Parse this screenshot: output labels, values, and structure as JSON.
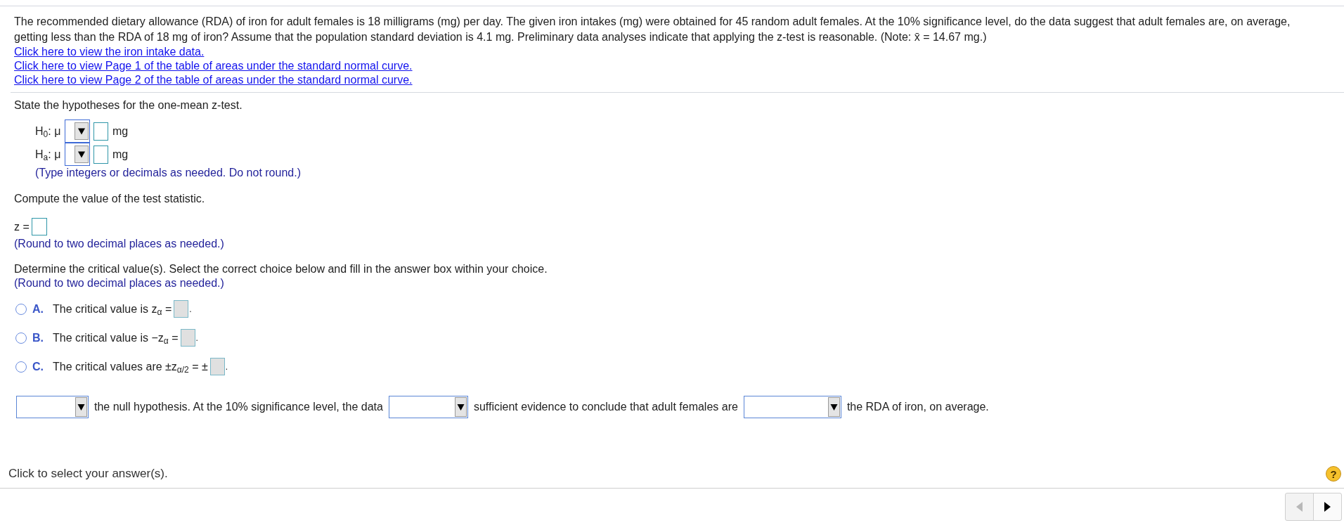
{
  "problem": {
    "paragraph": "The recommended dietary allowance (RDA) of iron for adult females is 18 milligrams (mg) per day. The given iron intakes (mg) were obtained for 45 random adult females. At the 10% significance level, do the data suggest that adult females are, on average, getting less than the RDA of 18 mg of iron? Assume that the population standard deviation is 4.1 mg. Preliminary data analyses indicate that applying the z-test is reasonable. (Note: x̄ = 14.67 mg.)",
    "links": [
      "Click here to view the iron intake data.",
      "Click here to view Page 1 of the table of areas under the standard normal curve.",
      "Click here to view Page 2 of the table of areas under the standard normal curve."
    ]
  },
  "hypotheses": {
    "prompt": "State the hypotheses for the one-mean z-test.",
    "rows": [
      {
        "label": "H$_{0}$: μ",
        "unit": "mg"
      },
      {
        "label": "H$_{a}$: μ",
        "unit": "mg"
      }
    ],
    "hint": "(Type integers or decimals as needed. Do not round.)"
  },
  "test_statistic": {
    "prompt": "Compute the value of the test statistic.",
    "label": "z =",
    "hint": "(Round to two decimal places as needed.)"
  },
  "critical_values": {
    "prompt": "Determine the critical value(s). Select the correct choice below and fill in the answer box within your choice.",
    "hint": "(Round to two decimal places as needed.)",
    "choices": [
      {
        "letter": "A.",
        "text": "The critical value is z$_{α}$ =",
        "after": ".",
        "selected": false
      },
      {
        "letter": "B.",
        "text": "The critical value is  −z$_{α}$ =",
        "after": ".",
        "selected": false
      },
      {
        "letter": "C.",
        "text": "The critical values are  ±z$_{α/2}$ = ±",
        "after": ".",
        "selected": false
      }
    ]
  },
  "conclusion": {
    "parts": [
      {
        "kind": "dropdown"
      },
      {
        "kind": "text",
        "text": "the null hypothesis. At the 10% significance level, the data"
      },
      {
        "kind": "dropdown"
      },
      {
        "kind": "text",
        "text": "sufficient evidence to conclude that adult females are"
      },
      {
        "kind": "dropdown"
      },
      {
        "kind": "text",
        "text": "the RDA of iron, on average."
      }
    ]
  },
  "footer": {
    "status": "Click to select your answer(s).",
    "help": "?"
  },
  "navigation": [
    {
      "kind": "previous",
      "disabled": true
    },
    {
      "kind": "next",
      "disabled": false
    }
  ]
}
